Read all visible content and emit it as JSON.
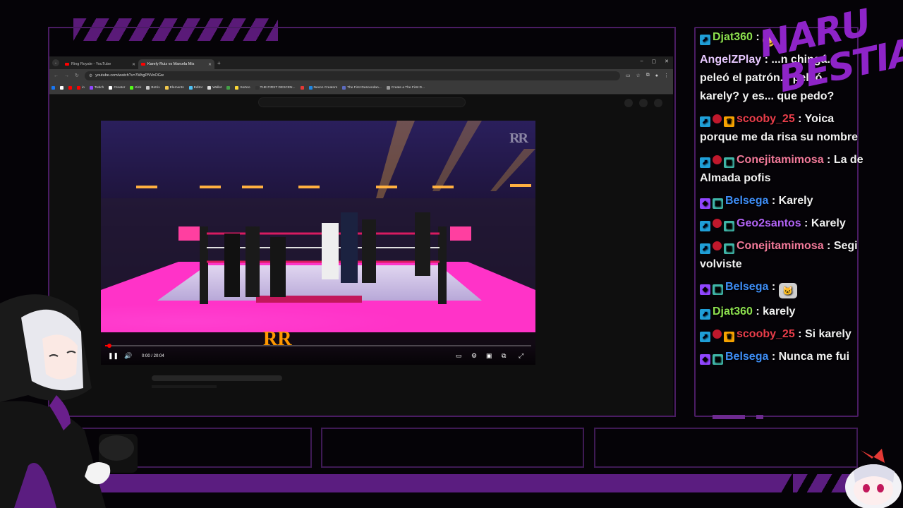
{
  "browser": {
    "tabs": [
      {
        "label": "Ring Royale - YouTube",
        "active": false
      },
      {
        "label": "Karely Ruiz vs Marcela Mis",
        "active": true
      }
    ],
    "new_tab": "+",
    "url": "youtube.com/watch?v=7MhgPNVoOGw",
    "bookmarks": [
      {
        "label": "",
        "color": "#1877f2"
      },
      {
        "label": "",
        "color": "#ffffff"
      },
      {
        "label": "",
        "color": "#ff0000"
      },
      {
        "label": "io",
        "color": "#ff0000"
      },
      {
        "label": "Twitch",
        "color": "#9146ff"
      },
      {
        "label": "Creator",
        "color": "#ffffff"
      },
      {
        "label": "Kick",
        "color": "#53fc18"
      },
      {
        "label": "Botrix",
        "color": "#cccccc"
      },
      {
        "label": "Elements",
        "color": "#f2c94c"
      },
      {
        "label": "Editor",
        "color": "#4fc3f7"
      },
      {
        "label": "Wallet",
        "color": "#dddddd"
      },
      {
        "label": "",
        "color": "#43a047"
      },
      {
        "label": "Sorteo",
        "color": "#fdd835"
      },
      {
        "label": "THE FIRST DESCEN...",
        "color": "#333333"
      },
      {
        "label": "",
        "color": "#e53935"
      },
      {
        "label": "Nexon Creators",
        "color": "#1e88e5"
      },
      {
        "label": "The First Descendan...",
        "color": "#5c6bc0"
      },
      {
        "label": "Create a The First D...",
        "color": "#999999"
      }
    ]
  },
  "player": {
    "time": "0:00 / 20:04",
    "progress": 0.01,
    "watermark": "RR"
  },
  "chat": [
    {
      "user": "Djat360",
      "color": "#8de04f",
      "badges": [
        "prime"
      ],
      "text": "",
      "emote": "emoji"
    },
    {
      "user": "AngelZPlay",
      "color": "#e7c8ff",
      "badges": [],
      "text": "...n chingá... peleó el patrón... peleó karely? y es... que pedo?",
      "emote": ""
    },
    {
      "user": "scooby_25",
      "color": "#e83d4a",
      "badges": [
        "prime",
        "red",
        "crown"
      ],
      "text": "Yoica porque me da risa su nombre",
      "emote": ""
    },
    {
      "user": "Conejitamimosa",
      "color": "#f27a9a",
      "badges": [
        "prime",
        "red",
        "gift"
      ],
      "text": "La de Almada pofis",
      "emote": ""
    },
    {
      "user": "Belsega",
      "color": "#3e8ef7",
      "badges": [
        "cube",
        "gift"
      ],
      "text": "Karely",
      "emote": ""
    },
    {
      "user": "Geo2santos",
      "color": "#b263f5",
      "badges": [
        "prime",
        "red",
        "gift"
      ],
      "text": "Karely",
      "emote": ""
    },
    {
      "user": "Conejitamimosa",
      "color": "#f27a9a",
      "badges": [
        "prime",
        "red",
        "gift"
      ],
      "text": "Segi volviste",
      "emote": ""
    },
    {
      "user": "Belsega",
      "color": "#3e8ef7",
      "badges": [
        "cube",
        "gift"
      ],
      "text": "",
      "emote": "cat"
    },
    {
      "user": "Djat360",
      "color": "#8de04f",
      "badges": [
        "prime"
      ],
      "text": "karely",
      "emote": ""
    },
    {
      "user": "scooby_25",
      "color": "#e83d4a",
      "badges": [
        "prime",
        "red",
        "crown"
      ],
      "text": "Si karely",
      "emote": ""
    },
    {
      "user": "Belsega",
      "color": "#3e8ef7",
      "badges": [
        "cube",
        "gift"
      ],
      "text": "Nunca me fui",
      "emote": ""
    }
  ],
  "brand": {
    "line1": "NARU",
    "line2": "BESTIA",
    "color": "#8e24c8"
  }
}
